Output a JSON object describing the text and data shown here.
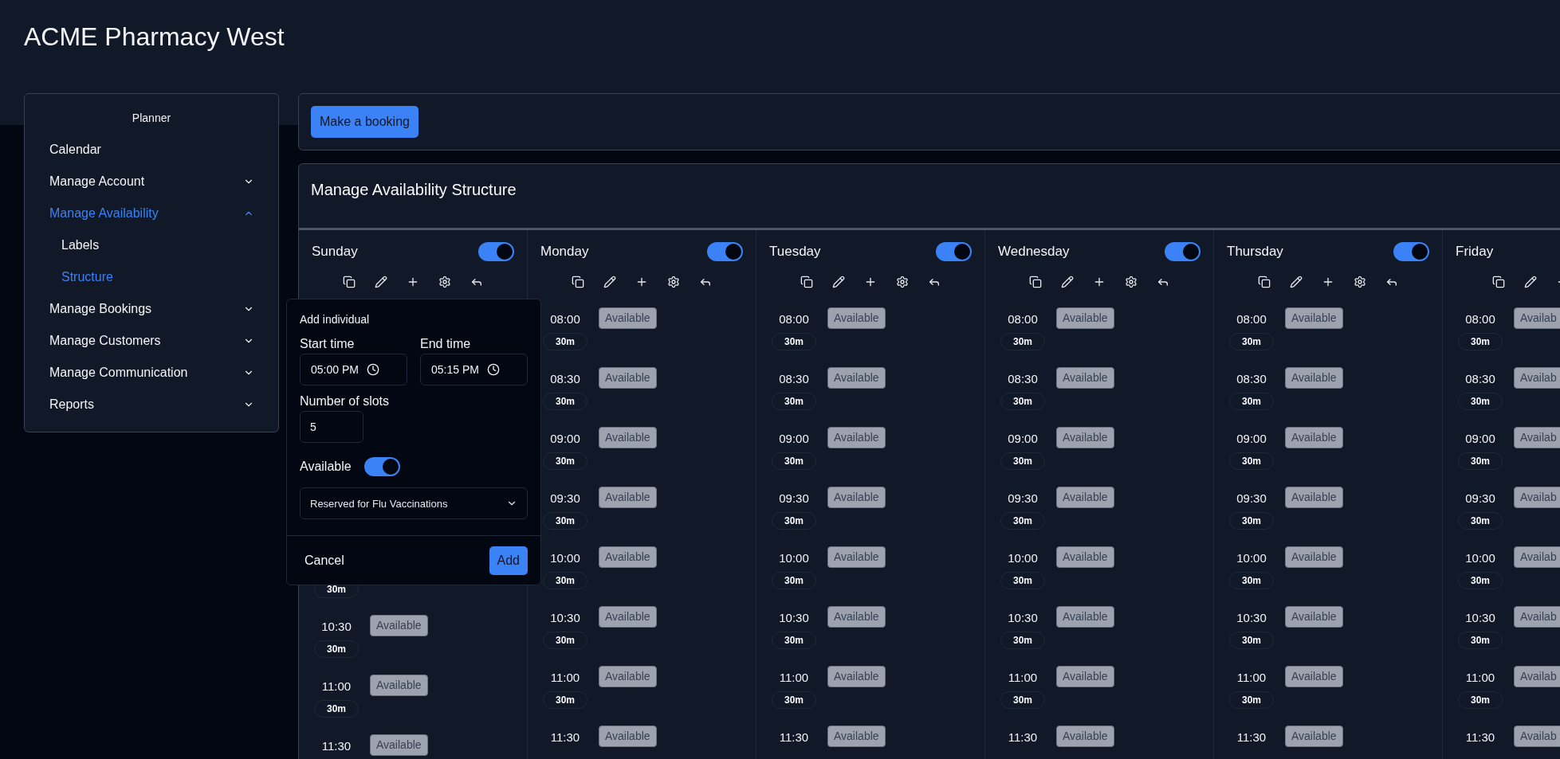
{
  "title": "ACME Pharmacy West",
  "sidebar": {
    "heading": "Planner",
    "items": [
      {
        "label": "Calendar",
        "selected": false
      },
      {
        "label": "Manage Account",
        "selected": false,
        "expanded": false
      },
      {
        "label": "Manage Availability",
        "selected": true,
        "expanded": true,
        "children": [
          {
            "label": "Labels",
            "selected": false
          },
          {
            "label": "Structure",
            "selected": true
          }
        ]
      },
      {
        "label": "Manage Bookings",
        "selected": false,
        "expanded": false
      },
      {
        "label": "Manage Customers",
        "selected": false,
        "expanded": false
      },
      {
        "label": "Manage Communication",
        "selected": false,
        "expanded": false
      },
      {
        "label": "Reports",
        "selected": false,
        "expanded": false
      }
    ]
  },
  "booking_button": "Make a booking",
  "structure": {
    "title": "Manage Availability Structure",
    "days": [
      {
        "name": "Sunday",
        "enabled": true,
        "popover": true,
        "slots": [
          {
            "duration": "30m"
          },
          {
            "time": "10:30",
            "duration": "30m",
            "status": "Available"
          },
          {
            "time": "11:00",
            "duration": "30m",
            "status": "Available"
          },
          {
            "time": "11:30",
            "status": "Available"
          }
        ]
      },
      {
        "name": "Monday",
        "enabled": true,
        "slots": [
          {
            "time": "08:00",
            "duration": "30m",
            "status": "Available"
          },
          {
            "time": "08:30",
            "duration": "30m",
            "status": "Available"
          },
          {
            "time": "09:00",
            "duration": "30m",
            "status": "Available"
          },
          {
            "time": "09:30",
            "duration": "30m",
            "status": "Available"
          },
          {
            "time": "10:00",
            "duration": "30m",
            "status": "Available"
          },
          {
            "time": "10:30",
            "duration": "30m",
            "status": "Available"
          },
          {
            "time": "11:00",
            "duration": "30m",
            "status": "Available"
          },
          {
            "time": "11:30",
            "status": "Available"
          }
        ]
      },
      {
        "name": "Tuesday",
        "enabled": true,
        "slots": [
          {
            "time": "08:00",
            "duration": "30m",
            "status": "Available"
          },
          {
            "time": "08:30",
            "duration": "30m",
            "status": "Available"
          },
          {
            "time": "09:00",
            "duration": "30m",
            "status": "Available"
          },
          {
            "time": "09:30",
            "duration": "30m",
            "status": "Available"
          },
          {
            "time": "10:00",
            "duration": "30m",
            "status": "Available"
          },
          {
            "time": "10:30",
            "duration": "30m",
            "status": "Available"
          },
          {
            "time": "11:00",
            "duration": "30m",
            "status": "Available"
          },
          {
            "time": "11:30",
            "status": "Available"
          }
        ]
      },
      {
        "name": "Wednesday",
        "enabled": true,
        "slots": [
          {
            "time": "08:00",
            "duration": "30m",
            "status": "Available"
          },
          {
            "time": "08:30",
            "duration": "30m",
            "status": "Available"
          },
          {
            "time": "09:00",
            "duration": "30m",
            "status": "Available"
          },
          {
            "time": "09:30",
            "duration": "30m",
            "status": "Available"
          },
          {
            "time": "10:00",
            "duration": "30m",
            "status": "Available"
          },
          {
            "time": "10:30",
            "duration": "30m",
            "status": "Available"
          },
          {
            "time": "11:00",
            "duration": "30m",
            "status": "Available"
          },
          {
            "time": "11:30",
            "status": "Available"
          }
        ]
      },
      {
        "name": "Thursday",
        "enabled": true,
        "slots": [
          {
            "time": "08:00",
            "duration": "30m",
            "status": "Available"
          },
          {
            "time": "08:30",
            "duration": "30m",
            "status": "Available"
          },
          {
            "time": "09:00",
            "duration": "30m",
            "status": "Available"
          },
          {
            "time": "09:30",
            "duration": "30m",
            "status": "Available"
          },
          {
            "time": "10:00",
            "duration": "30m",
            "status": "Available"
          },
          {
            "time": "10:30",
            "duration": "30m",
            "status": "Available"
          },
          {
            "time": "11:00",
            "duration": "30m",
            "status": "Available"
          },
          {
            "time": "11:30",
            "status": "Available"
          }
        ]
      },
      {
        "name": "Friday",
        "slots": [
          {
            "time": "08:00",
            "duration": "30m",
            "status": "Availab"
          },
          {
            "time": "08:30",
            "duration": "30m",
            "status": "Availab"
          },
          {
            "time": "09:00",
            "duration": "30m",
            "status": "Availab"
          },
          {
            "time": "09:30",
            "duration": "30m",
            "status": "Availab"
          },
          {
            "time": "10:00",
            "duration": "30m",
            "status": "Availab"
          },
          {
            "time": "10:30",
            "duration": "30m",
            "status": "Availab"
          },
          {
            "time": "11:00",
            "duration": "30m",
            "status": "Availab"
          },
          {
            "time": "11:30",
            "status": "Availab"
          }
        ]
      }
    ]
  },
  "add_individual": {
    "title": "Add individual",
    "start_label": "Start time",
    "start_value": "05:00 PM",
    "end_label": "End time",
    "end_value": "05:15 PM",
    "slots_label": "Number of slots",
    "slots_value": "5",
    "available_label": "Available",
    "available_on": true,
    "label_value": "Reserved for Flu Vaccinations",
    "cancel": "Cancel",
    "add": "Add"
  }
}
